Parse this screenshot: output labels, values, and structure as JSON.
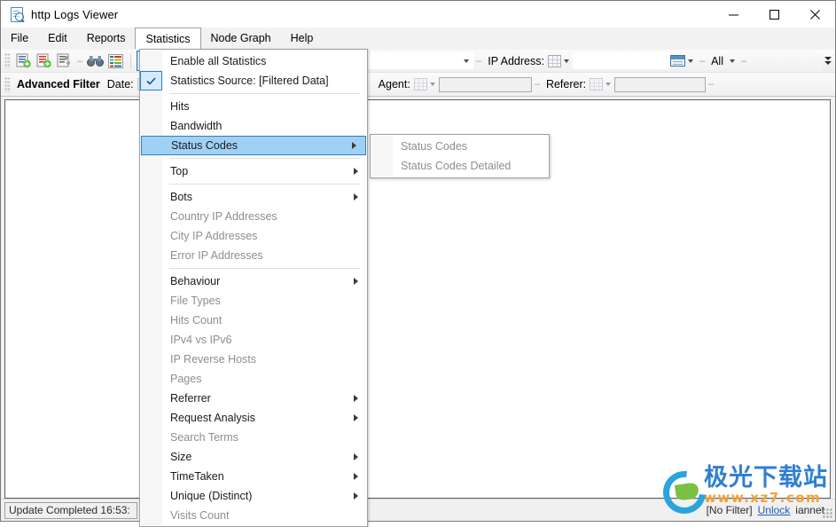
{
  "window": {
    "title": "http Logs Viewer",
    "icon": "document-search-icon",
    "minimize_label": "—",
    "maximize_label": "☐",
    "close_label": "✕"
  },
  "menubar": {
    "items": [
      {
        "label": "File",
        "open": false
      },
      {
        "label": "Edit",
        "open": false
      },
      {
        "label": "Reports",
        "open": false
      },
      {
        "label": "Statistics",
        "open": true
      },
      {
        "label": "Node Graph",
        "open": false
      },
      {
        "label": "Help",
        "open": false
      }
    ]
  },
  "toolbar": {
    "ip_address_label": "IP Address:",
    "all_label": "All",
    "overflow_label": "toolbar-overflow"
  },
  "filterbar": {
    "advanced_filter_label": "Advanced Filter",
    "date_label": "Date:",
    "agent_label": "Agent:",
    "referer_label": "Referer:",
    "agent_value": "",
    "referer_value": ""
  },
  "statistics_menu": {
    "items": [
      {
        "label": "Enable all Statistics",
        "checked": false,
        "disabled": false,
        "submenu": false,
        "highlighted": false,
        "separator_after": false
      },
      {
        "label": "Statistics Source: [Filtered Data]",
        "checked": true,
        "disabled": false,
        "submenu": false,
        "highlighted": false,
        "separator_after": true
      },
      {
        "label": "Hits",
        "checked": false,
        "disabled": false,
        "submenu": false,
        "highlighted": false,
        "separator_after": false
      },
      {
        "label": "Bandwidth",
        "checked": false,
        "disabled": false,
        "submenu": false,
        "highlighted": false,
        "separator_after": false
      },
      {
        "label": "Status Codes",
        "checked": false,
        "disabled": false,
        "submenu": true,
        "highlighted": true,
        "separator_after": true
      },
      {
        "label": "Top",
        "checked": false,
        "disabled": false,
        "submenu": true,
        "highlighted": false,
        "separator_after": true
      },
      {
        "label": "Bots",
        "checked": false,
        "disabled": false,
        "submenu": true,
        "highlighted": false,
        "separator_after": false
      },
      {
        "label": "Country IP Addresses",
        "checked": false,
        "disabled": true,
        "submenu": false,
        "highlighted": false,
        "separator_after": false
      },
      {
        "label": "City IP Addresses",
        "checked": false,
        "disabled": true,
        "submenu": false,
        "highlighted": false,
        "separator_after": false
      },
      {
        "label": "Error IP Addresses",
        "checked": false,
        "disabled": true,
        "submenu": false,
        "highlighted": false,
        "separator_after": true
      },
      {
        "label": "Behaviour",
        "checked": false,
        "disabled": false,
        "submenu": true,
        "highlighted": false,
        "separator_after": false
      },
      {
        "label": "File Types",
        "checked": false,
        "disabled": true,
        "submenu": false,
        "highlighted": false,
        "separator_after": false
      },
      {
        "label": "Hits Count",
        "checked": false,
        "disabled": true,
        "submenu": false,
        "highlighted": false,
        "separator_after": false
      },
      {
        "label": "IPv4 vs IPv6",
        "checked": false,
        "disabled": true,
        "submenu": false,
        "highlighted": false,
        "separator_after": false
      },
      {
        "label": "IP Reverse Hosts",
        "checked": false,
        "disabled": true,
        "submenu": false,
        "highlighted": false,
        "separator_after": false
      },
      {
        "label": "Pages",
        "checked": false,
        "disabled": true,
        "submenu": false,
        "highlighted": false,
        "separator_after": false
      },
      {
        "label": "Referrer",
        "checked": false,
        "disabled": false,
        "submenu": true,
        "highlighted": false,
        "separator_after": false
      },
      {
        "label": "Request Analysis",
        "checked": false,
        "disabled": false,
        "submenu": true,
        "highlighted": false,
        "separator_after": false
      },
      {
        "label": "Search Terms",
        "checked": false,
        "disabled": true,
        "submenu": false,
        "highlighted": false,
        "separator_after": false
      },
      {
        "label": "Size",
        "checked": false,
        "disabled": false,
        "submenu": true,
        "highlighted": false,
        "separator_after": false
      },
      {
        "label": "TimeTaken",
        "checked": false,
        "disabled": false,
        "submenu": true,
        "highlighted": false,
        "separator_after": false
      },
      {
        "label": "Unique (Distinct)",
        "checked": false,
        "disabled": false,
        "submenu": true,
        "highlighted": false,
        "separator_after": false
      },
      {
        "label": "Visits Count",
        "checked": false,
        "disabled": true,
        "submenu": false,
        "highlighted": false,
        "separator_after": false
      }
    ]
  },
  "status_codes_submenu": {
    "items": [
      {
        "label": "Status Codes",
        "disabled": true
      },
      {
        "label": "Status Codes Detailed",
        "disabled": true
      }
    ]
  },
  "statusbar": {
    "update_text": "Update Completed 16:53:",
    "filter_text": "[No Filter]",
    "unlock_text": "Unlock",
    "user_text": "iannet"
  },
  "watermark": {
    "cn_text": "极光下载站",
    "url_text": "www.xz7.com"
  },
  "colors": {
    "menu_highlight": "#9fd1f5",
    "menu_highlight_border": "#2a7fc9",
    "check_bg": "#d6eaf9",
    "disabled_text": "#8e8e8e",
    "link": "#1f5fbf",
    "watermark_blue": "#2f7fd0",
    "watermark_orange": "#f0a33a"
  }
}
